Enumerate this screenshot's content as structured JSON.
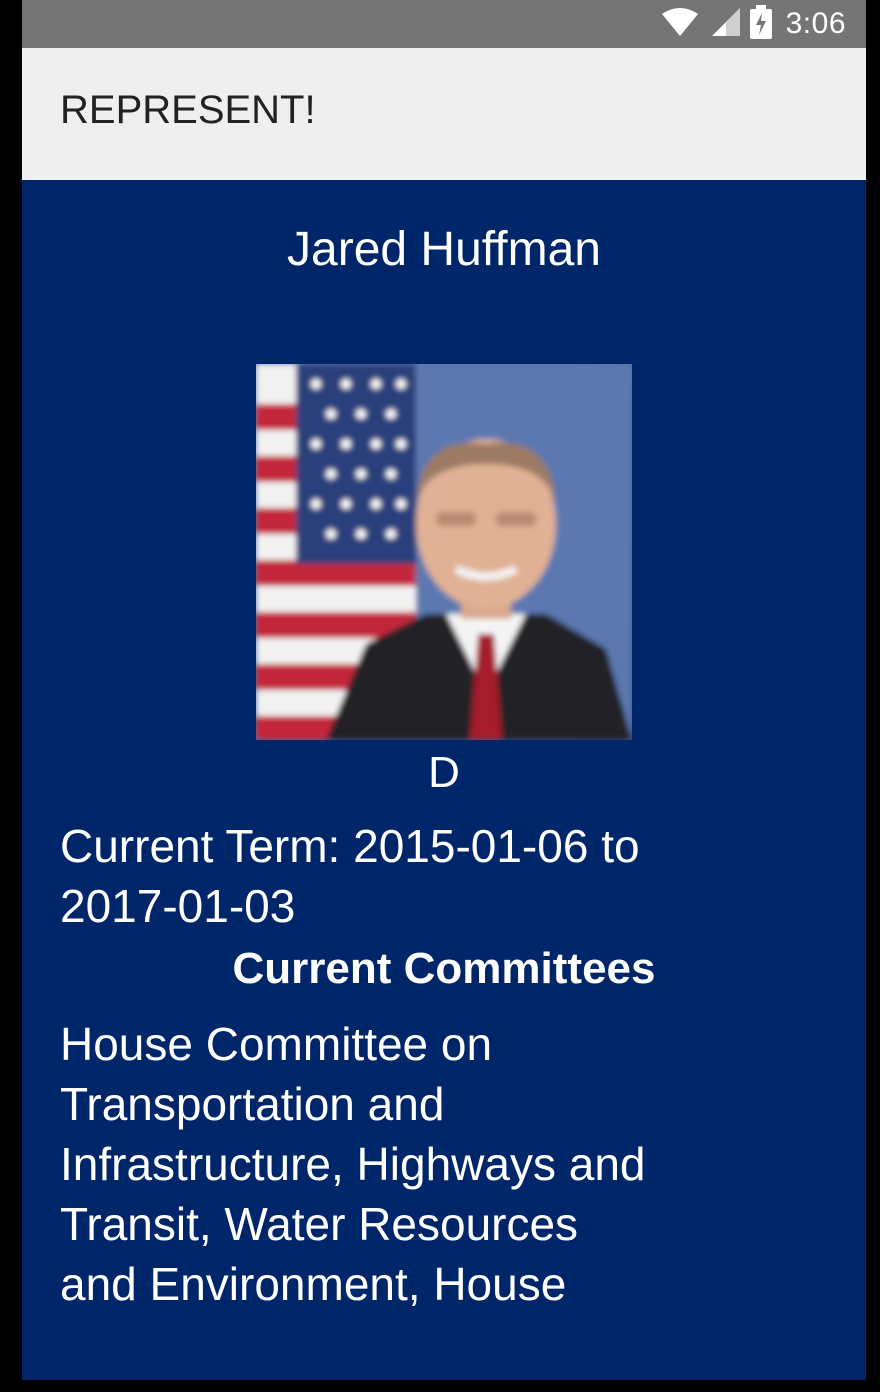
{
  "status_bar": {
    "time": "3:06",
    "icons": [
      "wifi-icon",
      "cell-signal-icon",
      "battery-charging-icon"
    ]
  },
  "app_bar": {
    "title": "REPRESENT!"
  },
  "representative": {
    "name": "Jared Huffman",
    "photo_description_icon": "portrait-photo",
    "party": "D",
    "current_term": "Current Term: 2015-01-06 to 2017-01-03",
    "committees_heading": "Current Committees",
    "committees_text": "House Committee on Transportation and Infrastructure, Highways and Transit, Water Resources and Environment, House"
  },
  "colors": {
    "status_bar": "#757575",
    "app_bar": "#efefef",
    "content_background": "#00266a",
    "text": "#ffffff"
  }
}
